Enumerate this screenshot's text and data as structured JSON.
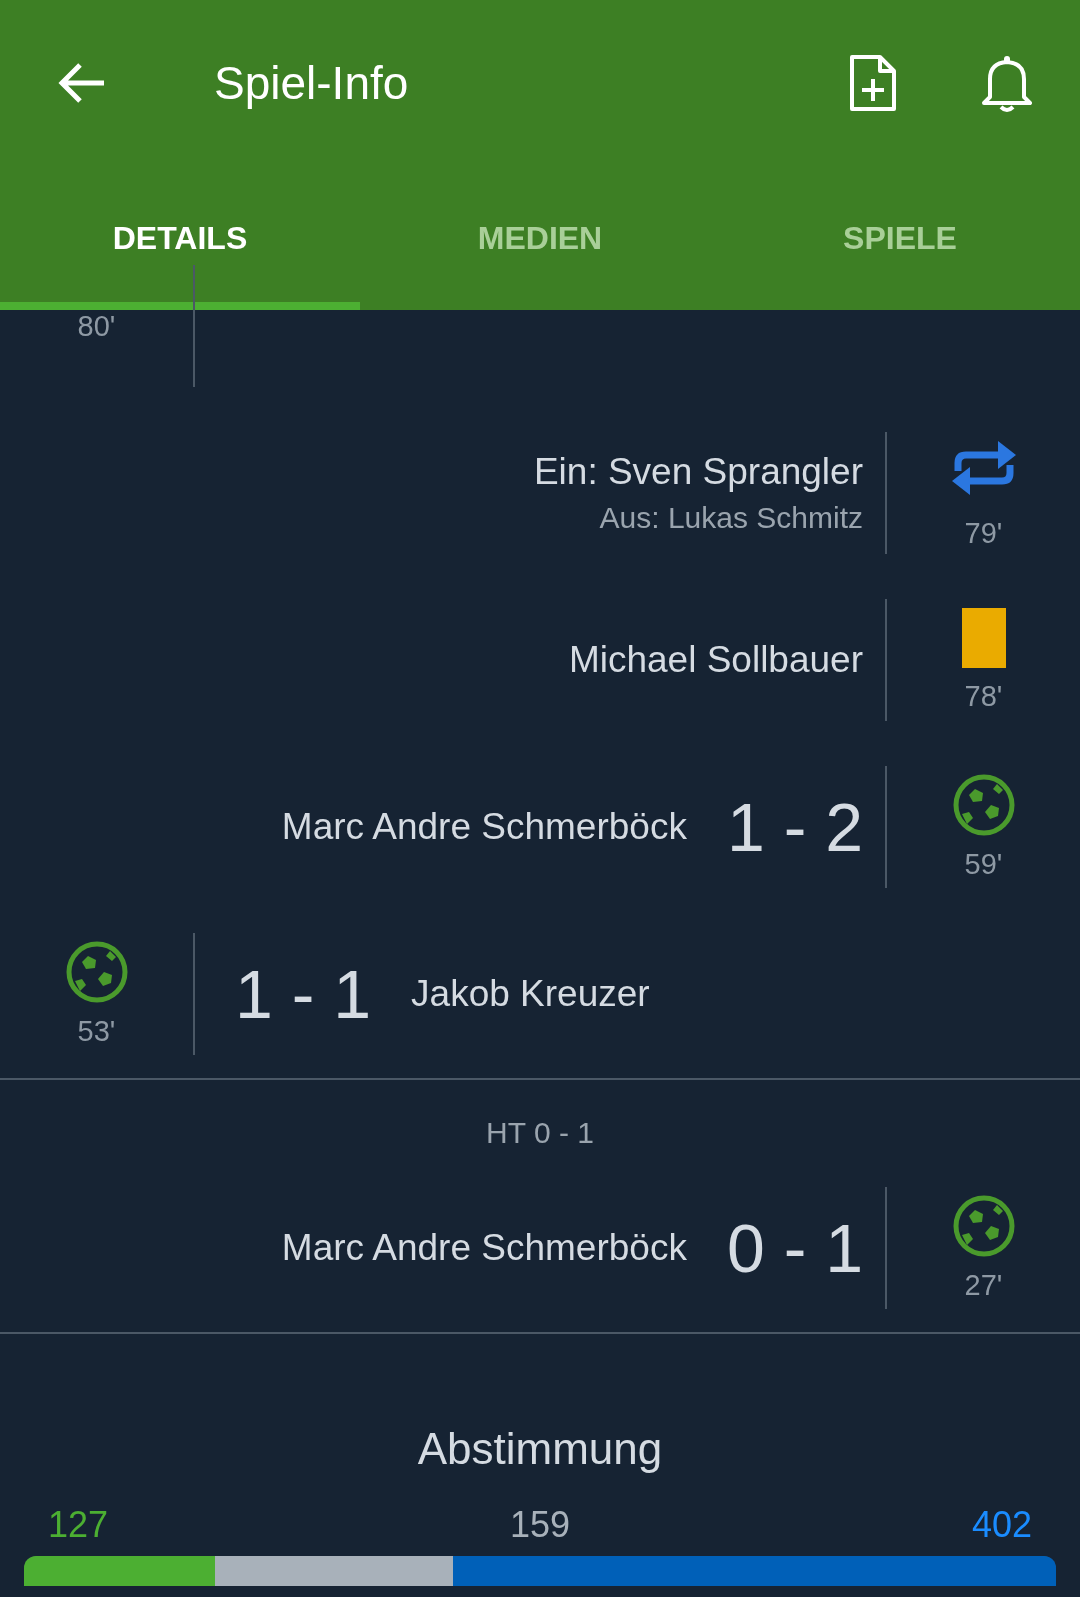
{
  "header": {
    "title": "Spiel-Info"
  },
  "tabs": [
    {
      "label": "DETAILS",
      "selected": true
    },
    {
      "label": "MEDIEN",
      "selected": false
    },
    {
      "label": "SPIELE",
      "selected": false
    }
  ],
  "events": [
    {
      "home": {
        "minute": "80'"
      }
    },
    {
      "away": {
        "kind": "substitution",
        "in": "Ein: Sven Sprangler",
        "out": "Aus: Lukas Schmitz",
        "minute": "79'"
      }
    },
    {
      "away": {
        "kind": "yellow_card",
        "player": "Michael Sollbauer",
        "minute": "78'"
      }
    },
    {
      "away": {
        "kind": "goal",
        "player": "Marc Andre Schmerböck",
        "score": "1 - 2",
        "minute": "59'"
      }
    },
    {
      "home": {
        "kind": "goal",
        "player": "Jakob Kreuzer",
        "score": "1 - 1",
        "minute": "53'"
      }
    }
  ],
  "halftime": "HT 0 - 1",
  "events_first_half": [
    {
      "away": {
        "kind": "goal",
        "player": "Marc Andre Schmerböck",
        "score": "0 - 1",
        "minute": "27'"
      }
    }
  ],
  "vote": {
    "title": "Abstimmung",
    "options": [
      {
        "count": "127",
        "level": 0.185,
        "color": "#4caf32"
      },
      {
        "count": "159",
        "level": 0.231,
        "color": "#a8b1ba"
      },
      {
        "count": "402",
        "level": 0.584,
        "color": "#0060b8"
      }
    ]
  }
}
